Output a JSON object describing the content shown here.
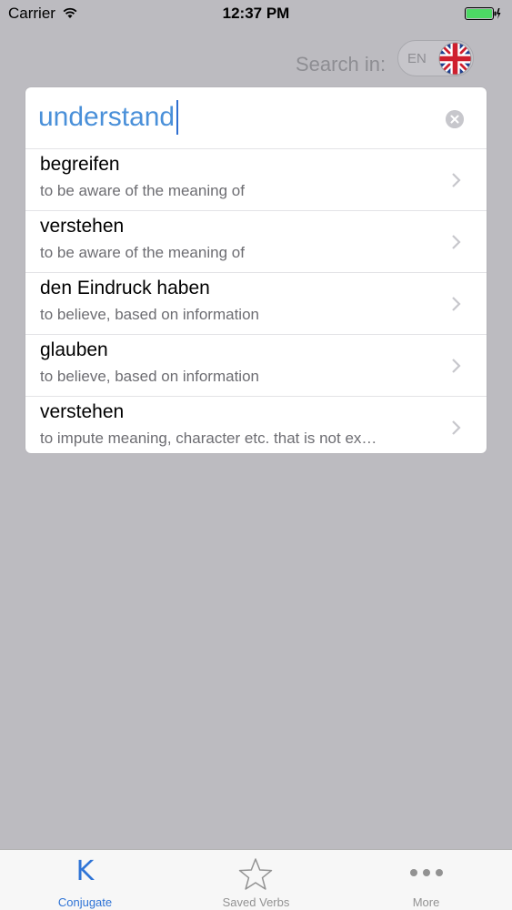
{
  "status_bar": {
    "carrier": "Carrier",
    "time": "12:37 PM",
    "icons": [
      "wifi-icon",
      "battery-icon"
    ]
  },
  "search_in": {
    "label": "Search in:",
    "language_code": "EN",
    "flag": "uk-flag-icon"
  },
  "search": {
    "value": "understand",
    "clear_icon": "clear-icon"
  },
  "results": [
    {
      "title": "begreifen",
      "subtitle": "to be aware of the meaning of"
    },
    {
      "title": "verstehen",
      "subtitle": "to be aware of the meaning of"
    },
    {
      "title": "den Eindruck haben",
      "subtitle": "to believe, based on information"
    },
    {
      "title": "glauben",
      "subtitle": "to believe, based on information"
    },
    {
      "title": "verstehen",
      "subtitle": "to impute meaning, character etc. that is not ex…"
    }
  ],
  "tab_bar": {
    "tabs": [
      {
        "label": "Conjugate",
        "icon": "K",
        "active": true
      },
      {
        "label": "Saved Verbs",
        "icon": "star-icon",
        "active": false
      },
      {
        "label": "More",
        "icon": "more-icon",
        "active": false
      }
    ]
  },
  "colors": {
    "background": "#bcbbc0",
    "accent": "#2f74d6",
    "search_text": "#4a90d9",
    "battery": "#4cd964"
  }
}
